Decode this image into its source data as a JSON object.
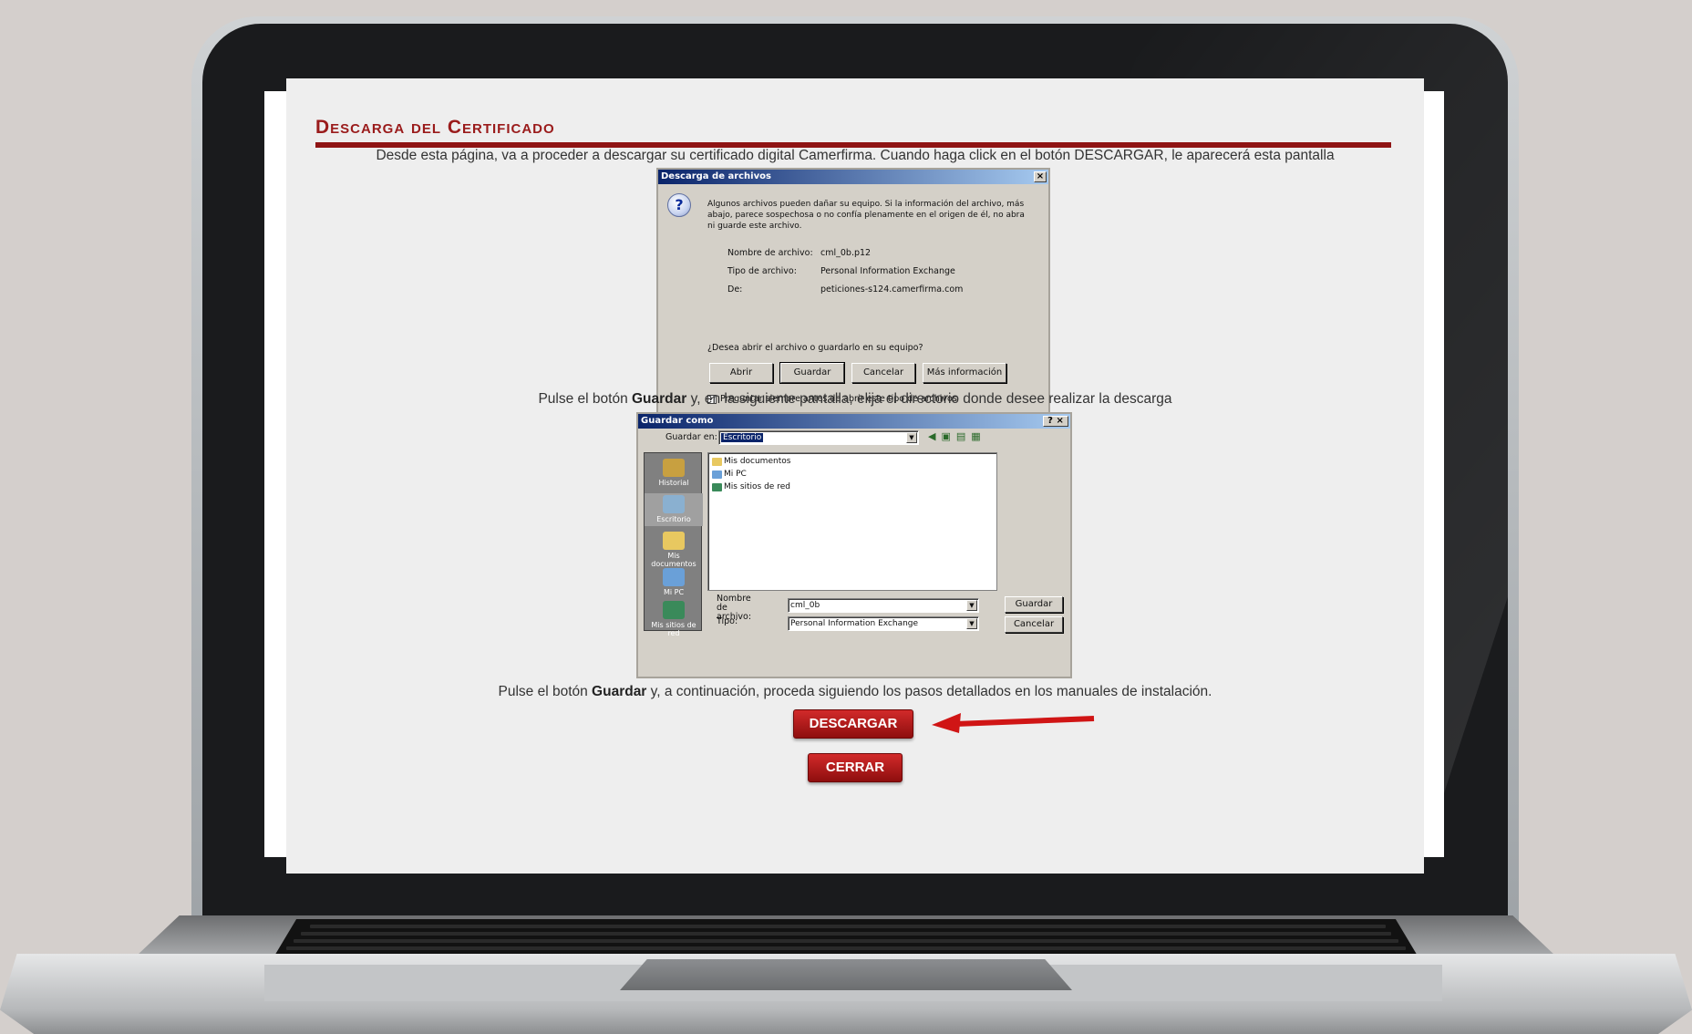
{
  "page": {
    "title": "Descarga del Certificado",
    "intro": "Desde esta página, va a proceder a descargar su certificado digital Camerfirma. Cuando haga click en el botón DESCARGAR, le aparecerá esta pantalla",
    "step2_pre": "Pulse el botón ",
    "step2_bold": "Guardar",
    "step2_post": " y, en la siguiente pantalla, elija el directorio donde desee realizar la descarga",
    "step3_pre": "Pulse el botón ",
    "step3_bold": "Guardar",
    "step3_post": " y, a continuación, proceda siguiendo los pasos detallados en los manuales de instalación.",
    "download_label": "DESCARGAR",
    "close_label": "CERRAR",
    "accent_color": "#9a1b1b"
  },
  "dialog_download": {
    "title": "Descarga de archivos",
    "close": "×",
    "warning": "Algunos archivos pueden dañar su equipo. Si la información del archivo, más abajo, parece sospechosa o no confía plenamente en el origen de él, no abra ni guarde este archivo.",
    "name_label": "Nombre de archivo:",
    "name_value": "cml_0b.p12",
    "type_label": "Tipo de archivo:",
    "type_value": "Personal Information Exchange",
    "from_label": "De:",
    "from_value": "peticiones-s124.camerfirma.com",
    "question": "¿Desea abrir el archivo o guardarlo en su equipo?",
    "btn_open": "Abrir",
    "btn_save": "Guardar",
    "btn_cancel": "Cancelar",
    "btn_more": "Más información",
    "always_ask": "Preguntar siempre antes de abrir este tipo de archivos",
    "icon": "question-icon"
  },
  "dialog_saveas": {
    "title": "Guardar como",
    "controls": "? ×",
    "save_in_label": "Guardar en:",
    "save_in_value": "Escritorio",
    "places": [
      "Historial",
      "Escritorio",
      "Mis documentos",
      "Mi PC",
      "Mis sitios de red"
    ],
    "files": [
      "Mis documentos",
      "Mi PC",
      "Mis sitios de red"
    ],
    "filename_label": "Nombre de archivo:",
    "filename_value": "cml_0b",
    "type_label": "Tipo:",
    "type_value": "Personal Information Exchange",
    "btn_save": "Guardar",
    "btn_cancel": "Cancelar"
  }
}
